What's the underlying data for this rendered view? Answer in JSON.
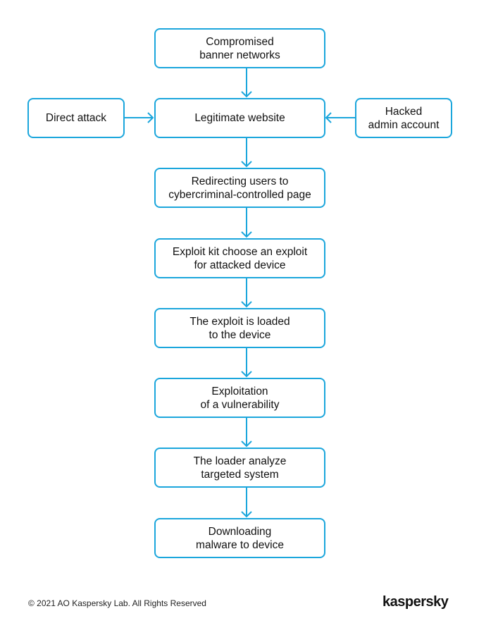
{
  "accent_color": "#1ba6dc",
  "nodes": {
    "banner": "Compromised\nbanner networks",
    "website": "Legitimate website",
    "direct": "Direct attack",
    "admin": "Hacked\nadmin account",
    "redirect": "Redirecting users to\ncybercriminal-controlled page",
    "exploit_kit": "Exploit kit choose an exploit\nfor attacked device",
    "loaded": "The exploit is loaded\nto the device",
    "exploitation": "Exploitation\nof a vulnerability",
    "loader": "The loader analyze\ntargeted system",
    "download": "Downloading\nmalware to device"
  },
  "footer": {
    "copyright": "© 2021 AO Kaspersky Lab. All Rights Reserved",
    "logo": "kaspersky"
  }
}
